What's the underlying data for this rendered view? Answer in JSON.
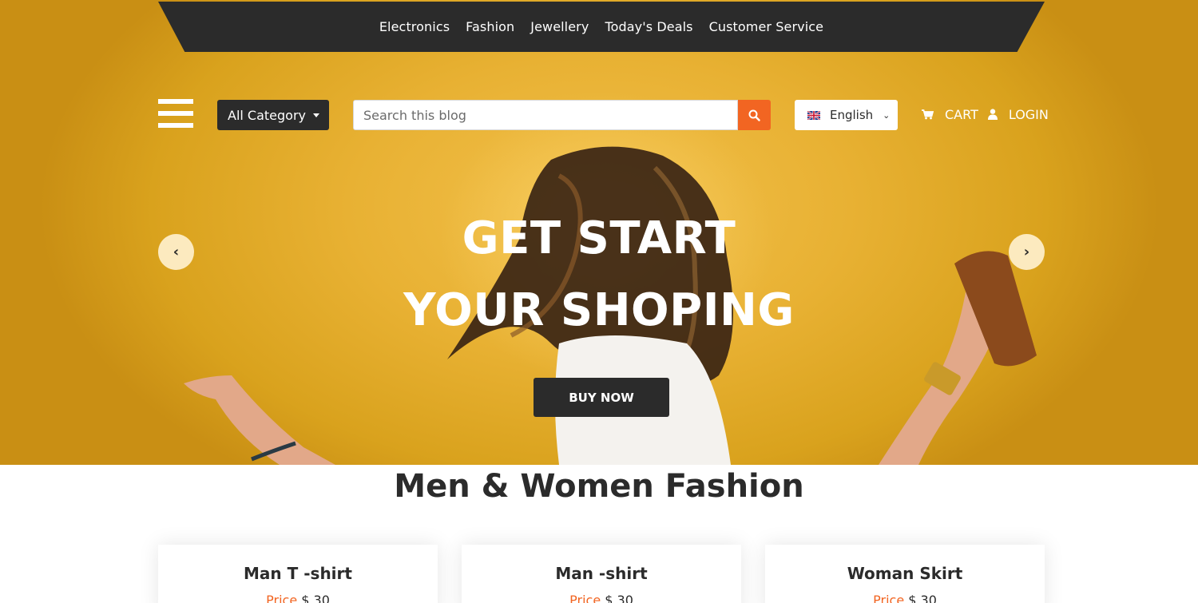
{
  "nav": {
    "links": [
      "Electronics",
      "Fashion",
      "Jewellery",
      "Today's Deals",
      "Customer Service"
    ]
  },
  "header": {
    "category_label": "All Category",
    "search_placeholder": "Search this blog",
    "language": "English",
    "cart_label": "CART",
    "login_label": "LOGIN"
  },
  "hero": {
    "title_line1": "GET START",
    "title_line2": "YOUR SHOPING",
    "cta_label": "BUY NOW"
  },
  "section": {
    "title": "Men & Women Fashion",
    "products": [
      {
        "name": "Man T -shirt",
        "price_label": "Price",
        "price": "$ 30"
      },
      {
        "name": "Man -shirt",
        "price_label": "Price",
        "price": "$ 30"
      },
      {
        "name": "Woman Skirt",
        "price_label": "Price",
        "price": "$ 30"
      }
    ]
  },
  "colors": {
    "accent": "#f26522",
    "dark": "#2b2b2b",
    "hero_bg": "#e8b133"
  },
  "icons": {
    "menu": "hamburger-icon",
    "search": "search-icon",
    "flag": "uk-flag-icon",
    "cart": "shopping-cart-icon",
    "user": "user-icon",
    "prev": "chevron-left-icon",
    "next": "chevron-right-icon"
  }
}
